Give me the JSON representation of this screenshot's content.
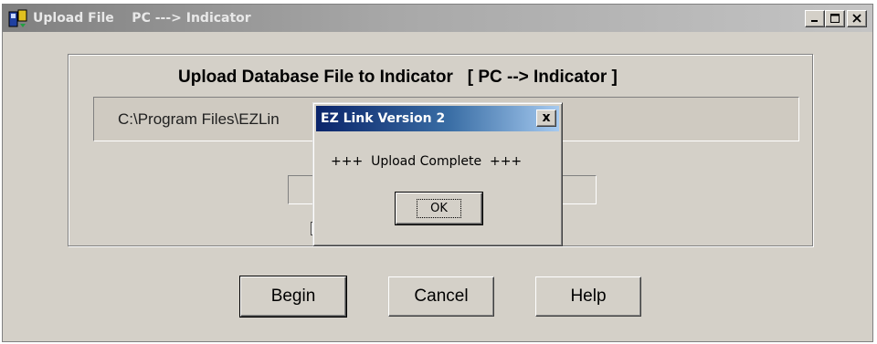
{
  "window": {
    "title": "Upload File    PC ---> Indicator",
    "icon": "upload-app-icon",
    "controls": [
      "minimize-icon",
      "maximize-icon",
      "close-icon"
    ]
  },
  "main": {
    "heading": "Upload Database File to Indicator   [ PC --> Indicator ]",
    "path_text": "C:\\Program Files\\EZLin"
  },
  "buttons": {
    "begin": "Begin",
    "cancel": "Cancel",
    "help": "Help"
  },
  "dialog": {
    "title": "EZ Link Version 2",
    "close_symbol": "x",
    "message": "+++  Upload Complete  +++",
    "ok_label": "OK"
  },
  "colors": {
    "window_face": "#d4d0c8",
    "dialog_titlebar": "#0a246a",
    "inactive_titlebar": "#808080"
  }
}
